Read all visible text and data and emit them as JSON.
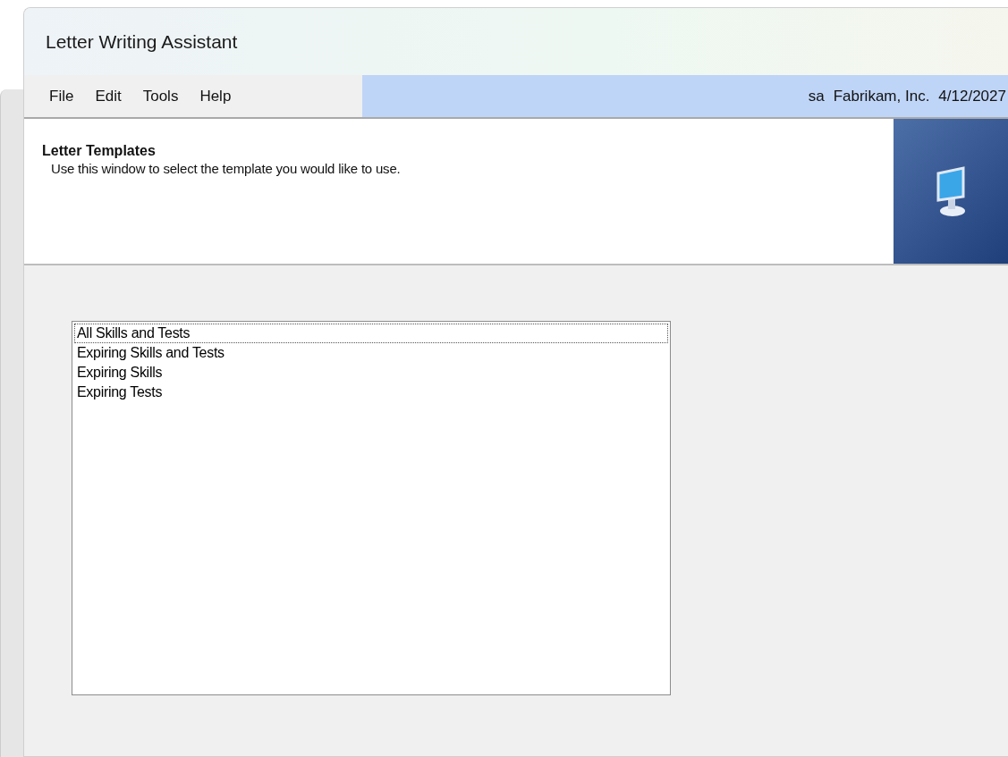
{
  "window": {
    "title": "Letter Writing Assistant"
  },
  "menu": [
    {
      "label": "File"
    },
    {
      "label": "Edit"
    },
    {
      "label": "Tools"
    },
    {
      "label": "Help"
    }
  ],
  "status": {
    "user": "sa",
    "company": "Fabrikam, Inc.",
    "date": "4/12/2027"
  },
  "header": {
    "title": "Letter Templates",
    "description": "Use this window to select the template you would like to use."
  },
  "templates": [
    {
      "label": "All Skills and Tests",
      "focused": true
    },
    {
      "label": "Expiring Skills and Tests",
      "focused": false
    },
    {
      "label": "Expiring Skills",
      "focused": false
    },
    {
      "label": "Expiring Tests",
      "focused": false
    }
  ]
}
